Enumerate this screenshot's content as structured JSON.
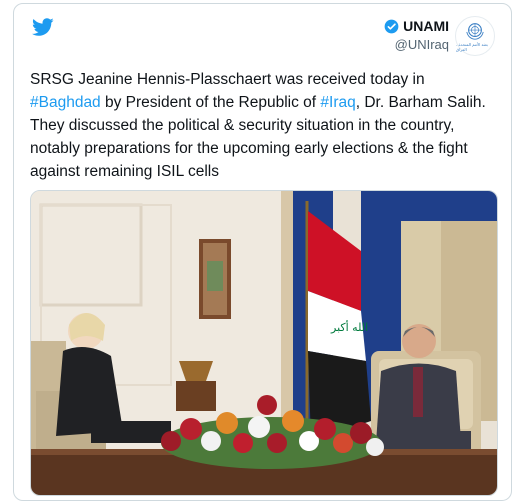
{
  "tweet": {
    "author": {
      "name": "UNAMI",
      "handle": "@UNIraq",
      "verified": true,
      "avatar_caption": "بعثة الأمم المتحدة - العراق"
    },
    "text_parts": [
      "SRSG Jeanine Hennis-Plasschaert was received today in ",
      "#Baghdad",
      " by President of the Republic of ",
      "#Iraq",
      ", Dr. Barham Salih. They discussed the political & security situation in the country, notably preparations for the upcoming early elections & the fight against remaining ISIL cells"
    ],
    "photo": {
      "flag_inscription": "الله أكبر"
    }
  },
  "colors": {
    "twitter_blue": "#1d9bf0",
    "hashtag_blue": "#1d9bf0",
    "flag_red": "#ce1126",
    "flag_green": "#007a3d",
    "curtain_blue": "#1f3f8a"
  },
  "icons": [
    "twitter-bird-icon",
    "verified-badge-icon",
    "un-emblem-icon"
  ]
}
